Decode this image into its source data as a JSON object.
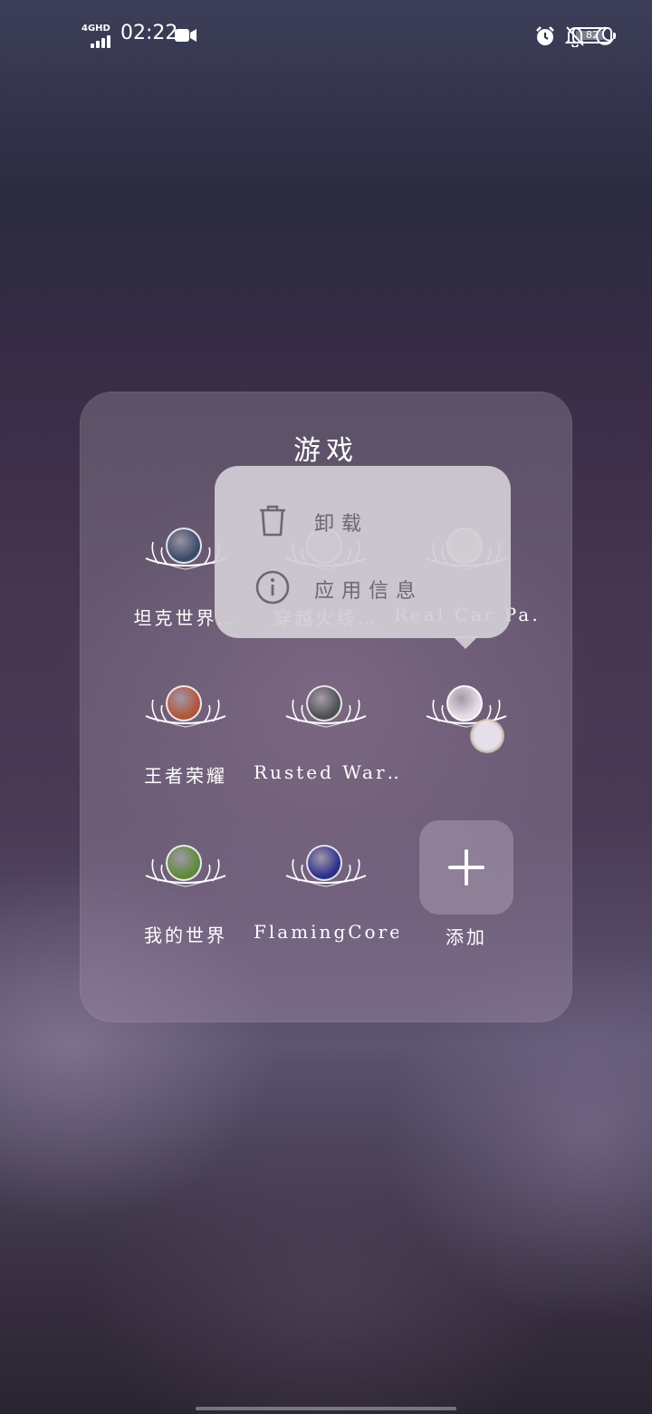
{
  "status_bar": {
    "network": "4GHD",
    "time": "02:22",
    "battery": "82",
    "battery_level": 0.82,
    "icons": [
      "video-camera-icon",
      "alarm-icon",
      "bell-off-icon",
      "moon-icon",
      "battery-icon"
    ]
  },
  "folder": {
    "title": "游戏",
    "apps": [
      {
        "name": "坦克世界…",
        "icon": "tank-world-icon",
        "color": "#3a4a6a"
      },
      {
        "name": "穿越火线…",
        "icon": "crossfire-icon",
        "color": "#7a7f8a"
      },
      {
        "name": "Real Car Pa…",
        "icon": "real-car-parking-icon",
        "color": "#c9b7a0"
      },
      {
        "name": "王者荣耀",
        "icon": "honor-of-kings-icon",
        "color": "#b0563a"
      },
      {
        "name": "Rusted War…",
        "icon": "rusted-warfare-icon",
        "color": "#4d4f52"
      },
      {
        "name": "",
        "icon": "anime-game-icon",
        "color": "#e8dfe6"
      },
      {
        "name": "我的世界",
        "icon": "minecraft-icon",
        "color": "#5d8a3a"
      },
      {
        "name": "FlamingCore",
        "icon": "flamingcore-icon",
        "color": "#2b2f8c"
      }
    ],
    "add_label": "添加"
  },
  "context_menu": {
    "items": [
      {
        "label": "卸载",
        "icon": "trash-icon"
      },
      {
        "label": "应用信息",
        "icon": "info-icon"
      }
    ]
  },
  "colors": {
    "popup_bg": "#d2ced6",
    "folder_bg": "#7a6e84"
  }
}
